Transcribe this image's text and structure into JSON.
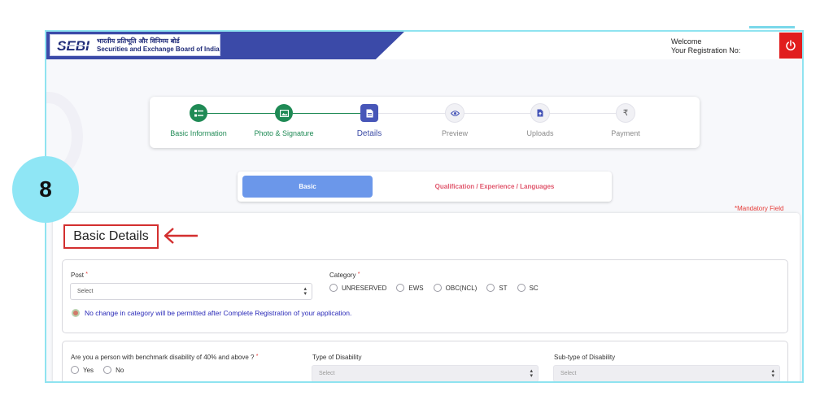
{
  "header": {
    "logo_mark": "SEBI",
    "org_name_hindi": "भारतीय प्रतिभूति और विनिमय बोर्ड",
    "org_name_english": "Securities and Exchange Board of India",
    "welcome_label": "Welcome",
    "registration_label": "Your Registration No:",
    "power_icon": "power-icon"
  },
  "stepper": {
    "steps": [
      {
        "label": "Basic Information",
        "state": "done",
        "icon": "list-icon"
      },
      {
        "label": "Photo & Signature",
        "state": "done",
        "icon": "image-icon"
      },
      {
        "label": "Details",
        "state": "active",
        "icon": "document-icon"
      },
      {
        "label": "Preview",
        "state": "pending",
        "icon": "eye-icon"
      },
      {
        "label": "Uploads",
        "state": "pending",
        "icon": "upload-file-icon"
      },
      {
        "label": "Payment",
        "state": "pending",
        "icon": "rupee-icon"
      }
    ]
  },
  "tabs": {
    "basic": "Basic",
    "qualification": "Qualification / Experience / Languages"
  },
  "mandatory_note": "*Mandatory Field",
  "section_title": "Basic Details",
  "step_badge": "8",
  "form": {
    "post_label": "Post",
    "post_placeholder": "Select",
    "category_label": "Category",
    "category_options": [
      "UNRESERVED",
      "EWS",
      "OBC(NCL)",
      "ST",
      "SC"
    ],
    "category_note": "No change in category will be permitted after Complete Registration of your application.",
    "disability_question": "Are you a person with benchmark disability of 40% and above ?",
    "disability_options": [
      "Yes",
      "No"
    ],
    "type_of_disability_label": "Type of Disability",
    "type_of_disability_placeholder": "Select",
    "subtype_disability_label": "Sub-type of Disability",
    "subtype_disability_placeholder": "Select",
    "required_mark": "*"
  },
  "colors": {
    "brand_blue": "#3b4aa8",
    "done_green": "#1f8a55",
    "active_indigo": "#4756b8",
    "tab_blue": "#6b97ea",
    "tab_pink": "#e0566c",
    "badge_cyan": "#8fe6f5",
    "highlight_red": "#d32f2f"
  }
}
